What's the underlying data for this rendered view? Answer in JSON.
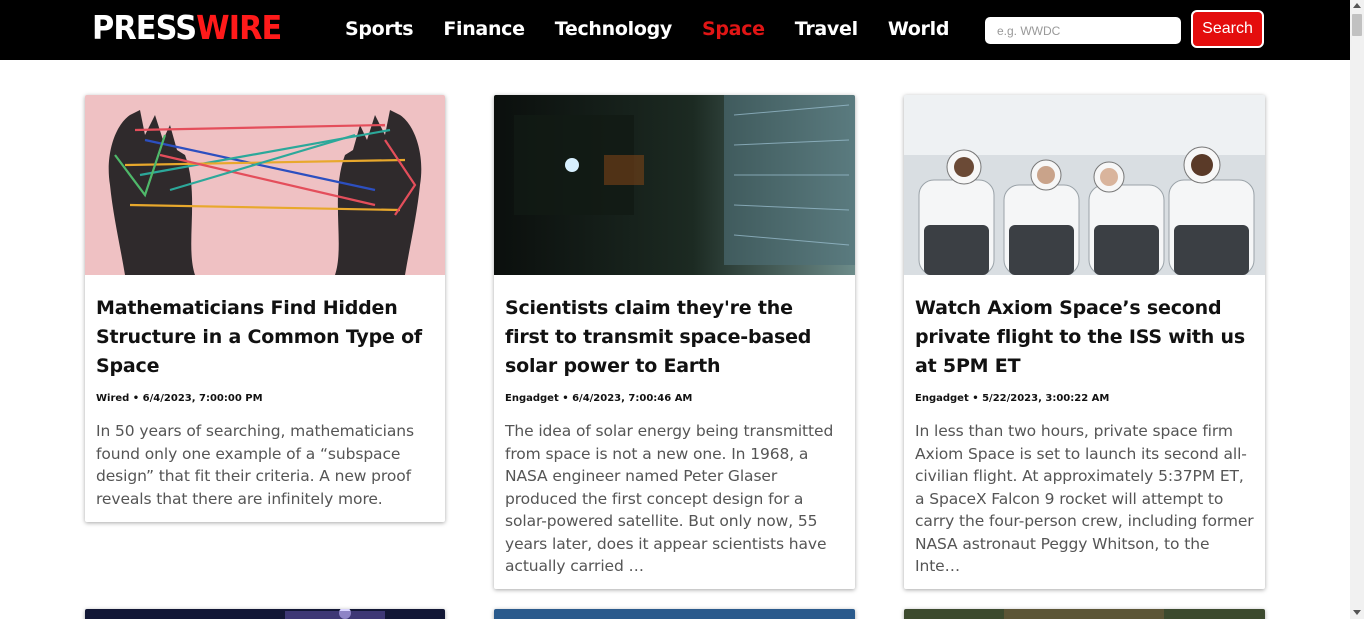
{
  "header": {
    "logo_part1": "PRESS",
    "logo_part2": "WIRE",
    "nav": [
      {
        "label": "Sports",
        "active": false
      },
      {
        "label": "Finance",
        "active": false
      },
      {
        "label": "Technology",
        "active": false
      },
      {
        "label": "Space",
        "active": true
      },
      {
        "label": "Travel",
        "active": false
      },
      {
        "label": "World",
        "active": false
      }
    ],
    "search_placeholder": "e.g. WWDC",
    "search_value": "",
    "search_button": "Search"
  },
  "colors": {
    "brand_red": "#e40d0d",
    "header_bg": "#000000"
  },
  "cards": [
    {
      "title": "Mathematicians Find Hidden Structure in a Common Type of Space",
      "meta": "Wired • 6/4/2023, 7:00:00 PM",
      "description": "In 50 years of searching, mathematicians found only one example of a “subspace design” that fit their criteria. A new proof reveals that there are infinitely more.",
      "image": "hands-string-illustration"
    },
    {
      "title": "Scientists claim they're the first to transmit space-based solar power to Earth",
      "meta": "Engadget • 6/4/2023, 7:00:46 AM",
      "description": "The idea of solar energy being transmitted from space is not a new one. In 1968, a NASA engineer named Peter Glaser produced the first concept design for a solar-powered satellite. But only now, 55 years later, does it appear scientists have actually carried …",
      "image": "satellite-interior-photo"
    },
    {
      "title": "Watch Axiom Space’s second private flight to the ISS with us at 5PM ET",
      "meta": "Engadget • 5/22/2023, 3:00:22 AM",
      "description": "In less than two hours, private space firm Axiom Space is set to launch its second all-civilian flight. At approximately 5:37PM ET, a SpaceX Falcon 9 rocket will attempt to carry the four-person crew, including former NASA astronaut Peggy Whitson, to the Inte…",
      "image": "astronauts-photo"
    }
  ]
}
